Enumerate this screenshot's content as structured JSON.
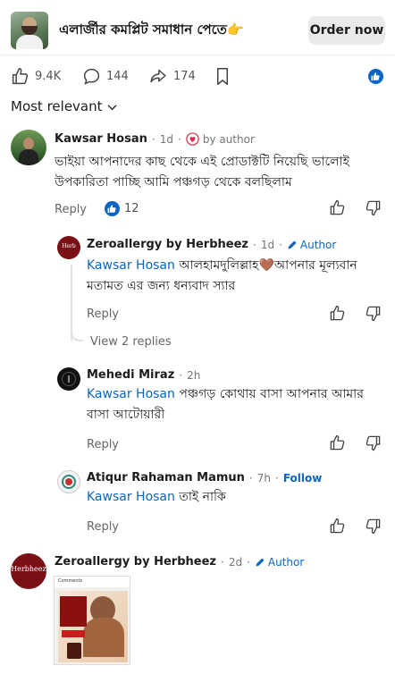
{
  "ad": {
    "title": "এলার্জীর কমপ্লিট সমাধান পেতে👉",
    "order_button": "Order now"
  },
  "actions": {
    "likes": "9.4K",
    "comments": "144",
    "shares": "174"
  },
  "sort": {
    "label": "Most relevant"
  },
  "comments": [
    {
      "name": "Kawsar Hosan",
      "time": "1d",
      "sep": "·",
      "badge": "by author",
      "text": "ভাইয়া আপনাদের কাছ থেকে এই প্রোডাক্টটি নিয়েছি ভালোই উপকারিতা পাচ্ছি আমি পঞ্চগড় থেকে বলছিলাম",
      "reply_label": "Reply",
      "likes": "12"
    }
  ],
  "replies": [
    {
      "name": "Zeroallergy by Herbheez",
      "time": "1d",
      "sep": "·",
      "author_label": "Author",
      "mention": "Kawsar Hosan",
      "text": " আলহামদুলিল্লাহ🤎আপনার মূল্যবান",
      "text2": "মতামত এর জন্য ধন্যবাদ স্যার",
      "reply_label": "Reply",
      "view_replies": "View 2 replies"
    },
    {
      "name": "Mehedi Miraz",
      "time": "2h",
      "sep": "·",
      "mention": "Kawsar Hosan",
      "text": " পঞ্চগড় কোথায় বাসা আপনার আমার",
      "text2": "বাসা আটোয়ারী",
      "reply_label": "Reply"
    },
    {
      "name": "Atiqur Rahaman Mamun",
      "time": "7h",
      "sep": "·",
      "follow": "Follow",
      "mention": "Kawsar Hosan",
      "text": " তাই নাকি",
      "reply_label": "Reply"
    }
  ],
  "bottom_comment": {
    "name": "Zeroallergy by Herbheez",
    "time": "2d",
    "sep": "·",
    "author_label": "Author",
    "logo_text": "Herbheez",
    "image_header": "Comments"
  },
  "colors": {
    "link": "#0a66c2",
    "brand": "#7a1016"
  }
}
